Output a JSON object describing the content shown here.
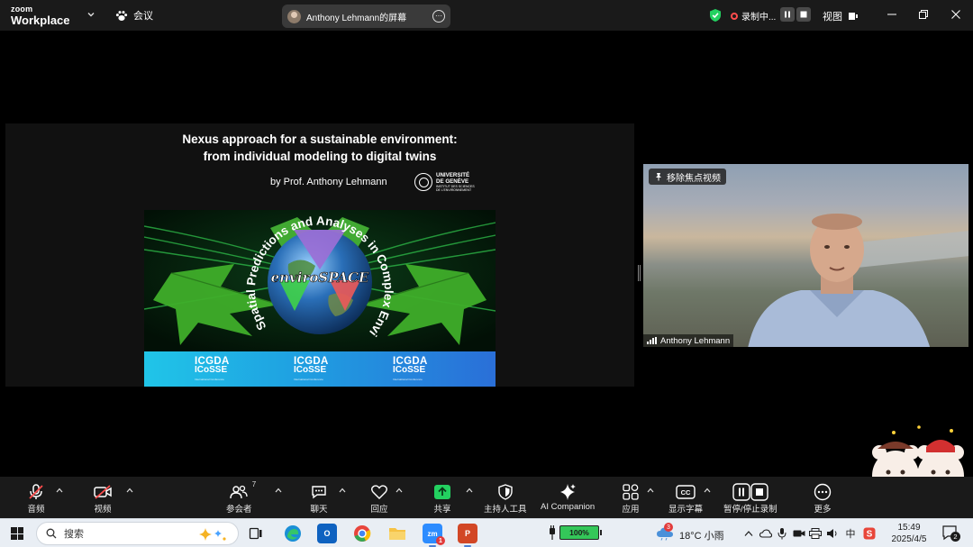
{
  "topbar": {
    "brand_small": "zoom",
    "brand_large": "Workplace",
    "meeting_label": "会议",
    "share_label": "Anthony Lehmann的屏幕",
    "recording_label": "录制中...",
    "view_label": "视图"
  },
  "slide": {
    "title_line1": "Nexus approach for a sustainable environment:",
    "title_line2": "from individual modeling to digital twins",
    "byline": "by Prof. Anthony Lehmann",
    "university_line1": "UNIVERSITÉ",
    "university_line2": "DE GENÈVE",
    "university_sub1": "INSTITUT DES SCIENCES",
    "university_sub2": "DE L'ENVIRONNEMENT",
    "arc_text": "Spatial Predictions and Analyses in Complex Environments",
    "logo_text": "enviroSPACE",
    "banner_logos": [
      {
        "l1": "ICGDA",
        "l2": "ICoSSE",
        "l3": "International Conference"
      },
      {
        "l1": "ICGDA",
        "l2": "ICoSSE",
        "l3": "International Conference"
      },
      {
        "l1": "ICGDA",
        "l2": "ICoSSE",
        "l3": "International Conference"
      }
    ]
  },
  "video": {
    "unpin_label": "移除焦点视频",
    "participant_name": "Anthony Lehmann"
  },
  "toolbar": {
    "audio": "音频",
    "video": "视频",
    "participants": "参会者",
    "participants_count": "7",
    "chat": "聊天",
    "react": "回应",
    "share": "共享",
    "host_tools": "主持人工具",
    "ai_companion": "AI Companion",
    "apps": "应用",
    "captions": "显示字幕",
    "pause_record": "暂停/停止录制",
    "more": "更多"
  },
  "taskbar": {
    "search_label": "搜索",
    "battery": "100%",
    "weather": "18°C 小雨",
    "weather_badge": "3",
    "ime": "中",
    "time": "15:49",
    "date": "2025/4/5",
    "notifications": "2",
    "zoom_badge": "1"
  },
  "colors": {
    "accent_green": "#23d160",
    "record_red": "#ff4d4d",
    "banner_blue": "#1f9fe1"
  }
}
